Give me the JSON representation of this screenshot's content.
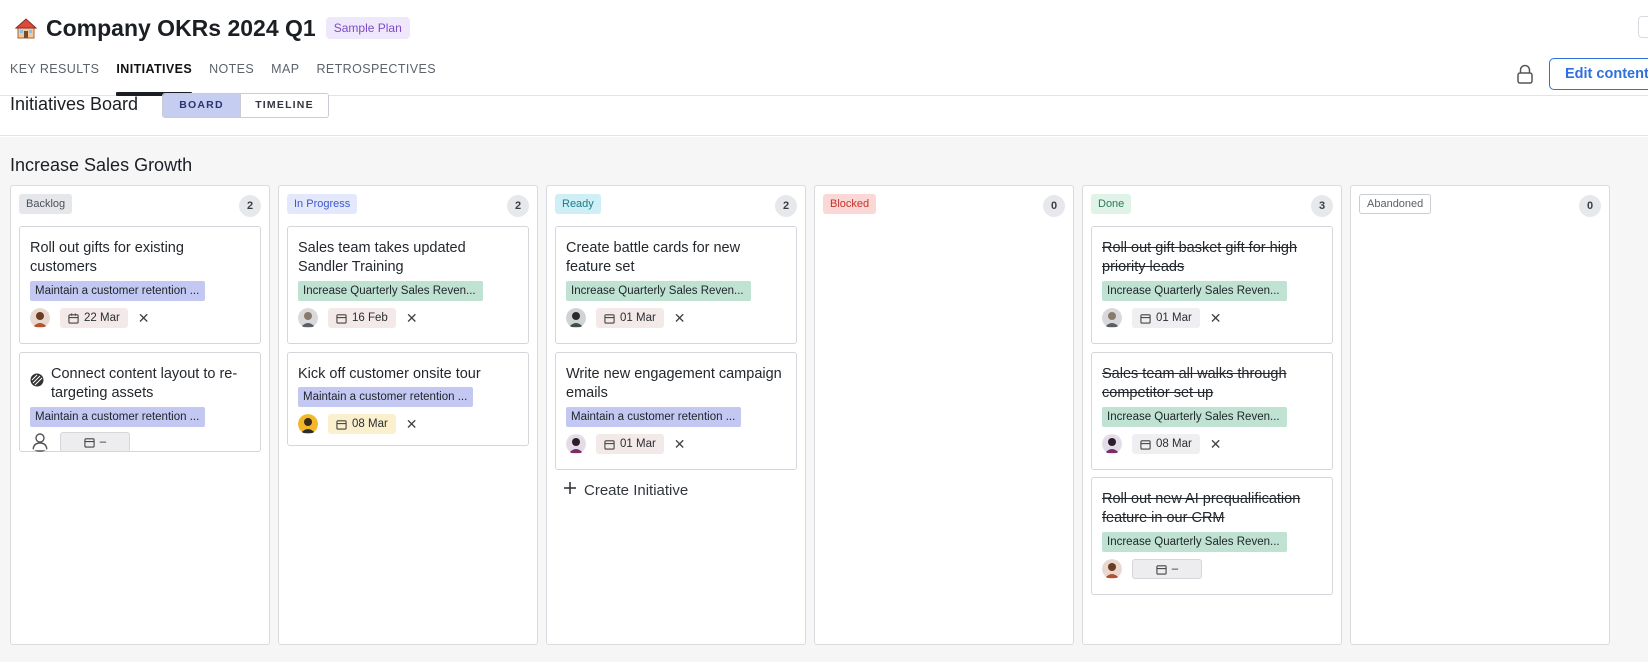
{
  "header": {
    "title": "Company OKRs 2024 Q1",
    "badge": "Sample Plan",
    "edit_label": "Edit content",
    "tabs": [
      "KEY RESULTS",
      "INITIATIVES",
      "NOTES",
      "MAP",
      "RETROSPECTIVES"
    ],
    "active_tab": "INITIATIVES"
  },
  "subheader": {
    "title": "Initiatives Board",
    "views": [
      "BOARD",
      "TIMELINE"
    ],
    "active_view": "BOARD"
  },
  "board": {
    "section_title": "Increase Sales Growth",
    "columns": [
      {
        "status": "Backlog",
        "count": "2",
        "cards": [
          {
            "title": "Roll out gifts for existing customers",
            "tag": "Maintain a customer retention ...",
            "date": "22 Mar"
          },
          {
            "title": "Connect content layout to re-targeting assets",
            "tag": "Maintain a customer retention ...",
            "date": "–"
          }
        ]
      },
      {
        "status": "In Progress",
        "count": "2",
        "cards": [
          {
            "title": "Sales team takes updated Sandler Training",
            "tag": "Increase Quarterly Sales Reven...",
            "date": "16 Feb"
          },
          {
            "title": "Kick off customer onsite tour",
            "tag": "Maintain a customer retention ...",
            "date": "08 Mar"
          }
        ]
      },
      {
        "status": "Ready",
        "count": "2",
        "cards": [
          {
            "title": "Create battle cards for new feature set",
            "tag": "Increase Quarterly Sales Reven...",
            "date": "01 Mar"
          },
          {
            "title": "Write new engagement campaign emails",
            "tag": "Maintain a customer retention ...",
            "date": "01 Mar"
          }
        ],
        "create_label": "Create Initiative"
      },
      {
        "status": "Blocked",
        "count": "0",
        "cards": []
      },
      {
        "status": "Done",
        "count": "3",
        "cards": [
          {
            "title": "Roll out gift basket gift for high priority leads",
            "tag": "Increase Quarterly Sales Reven...",
            "date": "01 Mar"
          },
          {
            "title": "Sales team all walks through competitor set up",
            "tag": "Increase Quarterly Sales Reven...",
            "date": "08 Mar"
          },
          {
            "title": "Roll out new AI prequalification feature in our CRM",
            "tag": "Increase Quarterly Sales Reven...",
            "date": "–"
          }
        ]
      },
      {
        "status": "Abandoned",
        "count": "0",
        "cards": []
      }
    ]
  },
  "colors": {
    "accent": "#2f6fde",
    "tag_retention": "#c3c8f2",
    "tag_revenue": "#bfe2d3",
    "blocked": "#fbd7d6",
    "ready": "#cdeff5",
    "done": "#dff3e9"
  },
  "icons": [
    "house-icon",
    "lock-icon",
    "calendar-icon",
    "close-icon",
    "plus-icon",
    "person-icon",
    "content-icon"
  ]
}
